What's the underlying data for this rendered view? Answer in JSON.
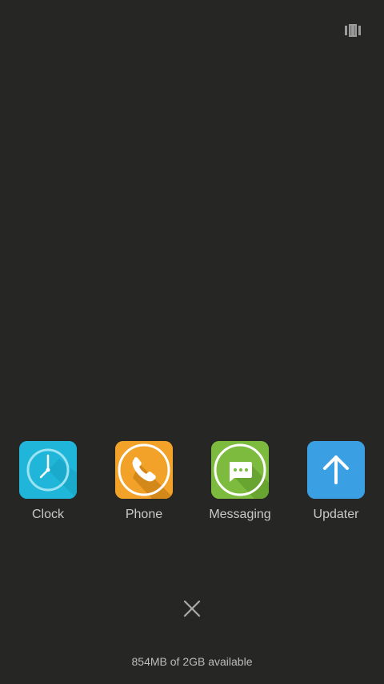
{
  "recents": {
    "apps": [
      {
        "label": "Clock",
        "icon": "clock-icon",
        "color": "#1fb6d9"
      },
      {
        "label": "Phone",
        "icon": "phone-icon",
        "color": "#f2a229"
      },
      {
        "label": "Messaging",
        "icon": "message-icon",
        "color": "#7dbb3f"
      },
      {
        "label": "Updater",
        "icon": "arrow-up-icon",
        "color": "#3b9fe3"
      }
    ]
  },
  "footer": {
    "close_icon": "close-icon",
    "memory": "854MB of 2GB available"
  },
  "header": {
    "view_toggle_icon": "layout-toggle-icon"
  },
  "theme": {
    "background": "#262725",
    "label_color": "#c9c9c9"
  }
}
